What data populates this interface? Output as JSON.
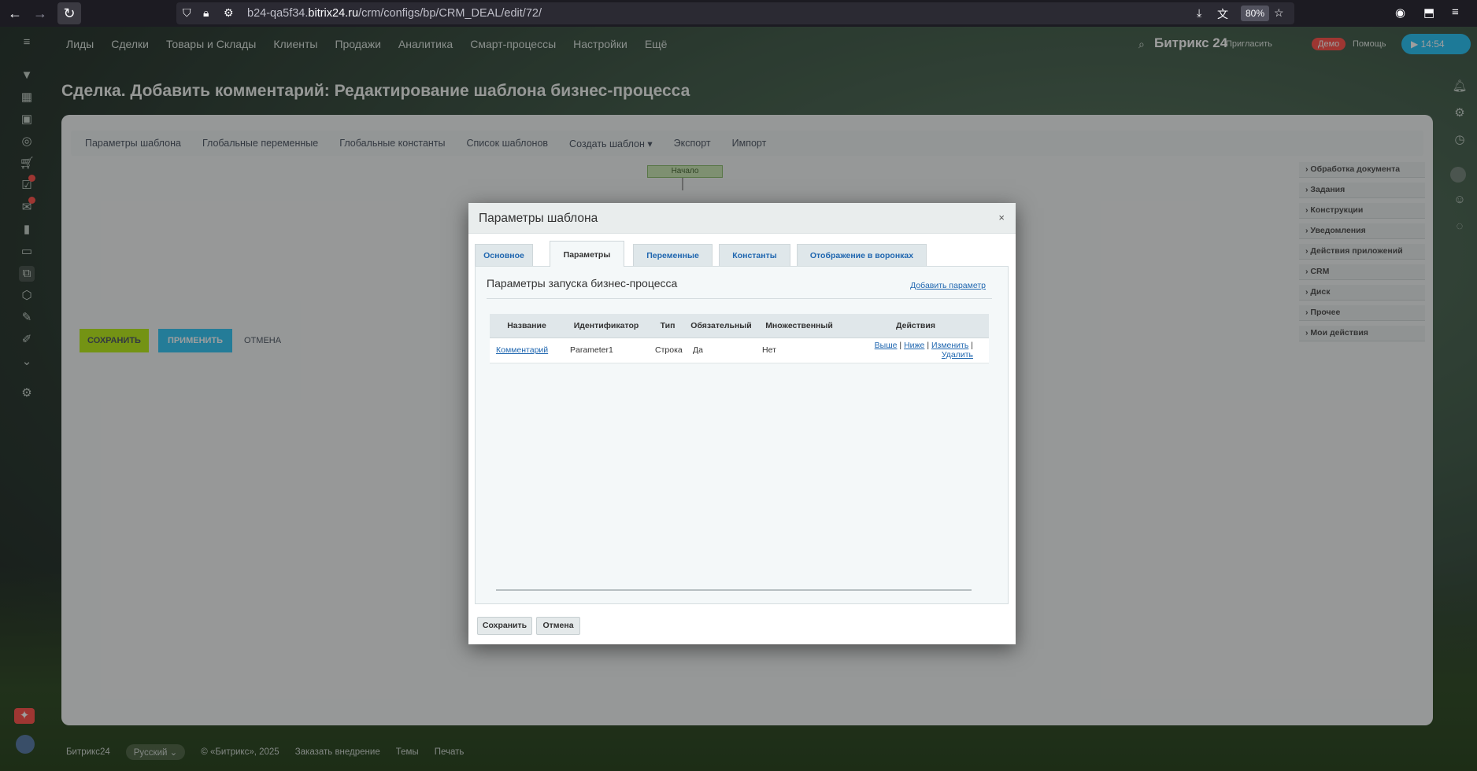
{
  "browser": {
    "url_prefix": "b24-qa5f34.",
    "url_domain": "bitrix24.ru",
    "url_path": "/crm/configs/bp/CRM_DEAL/edit/72/",
    "zoom": "80%"
  },
  "topnav": [
    "Лиды",
    "Сделки",
    "Товары и Склады",
    "Клиенты",
    "Продажи",
    "Аналитика",
    "Смарт-процессы",
    "Настройки",
    "Ещё"
  ],
  "header": {
    "logo": "Битрикс 24",
    "invite": "Пригласить",
    "demo": "Демо",
    "help": "Помощь",
    "time": "14:54"
  },
  "page": {
    "title": "Сделка. Добавить комментарий: Редактирование шаблона бизнес-процесса",
    "tabs": [
      "Параметры шаблона",
      "Глобальные переменные",
      "Глобальные константы",
      "Список шаблонов",
      "Создать шаблон",
      "Экспорт",
      "Импорт"
    ],
    "start_node": "Начало",
    "activities": [
      "Обработка документа",
      "Задания",
      "Конструкции",
      "Уведомления",
      "Действия приложений",
      "CRM",
      "Диск",
      "Прочее",
      "Мои действия"
    ],
    "save": "СОХРАНИТЬ",
    "apply": "ПРИМЕНИТЬ",
    "cancel": "ОТМЕНА"
  },
  "footer": [
    "Битрикс24",
    "Русский",
    "© «Битрикс», 2025",
    "Заказать внедрение",
    "Темы",
    "Печать"
  ],
  "dialog": {
    "title": "Параметры шаблона",
    "close": "×",
    "tabs": [
      "Основное",
      "Параметры",
      "Переменные",
      "Константы",
      "Отображение в воронках"
    ],
    "active_tab": "Параметры",
    "section_title": "Параметры запуска бизнес-процесса",
    "add_param": "Добавить параметр",
    "columns": [
      "Название",
      "Идентификатор",
      "Тип",
      "Обязательный",
      "Множественный",
      "Действия"
    ],
    "rows": [
      {
        "name": "Комментарий",
        "id": "Parameter1",
        "type": "Строка",
        "required": "Да",
        "multiple": "Нет"
      }
    ],
    "actions": {
      "up": "Выше",
      "down": "Ниже",
      "edit": "Изменить",
      "delete": "Удалить",
      "sep": "|"
    },
    "save": "Сохранить",
    "cancel": "Отмена"
  }
}
